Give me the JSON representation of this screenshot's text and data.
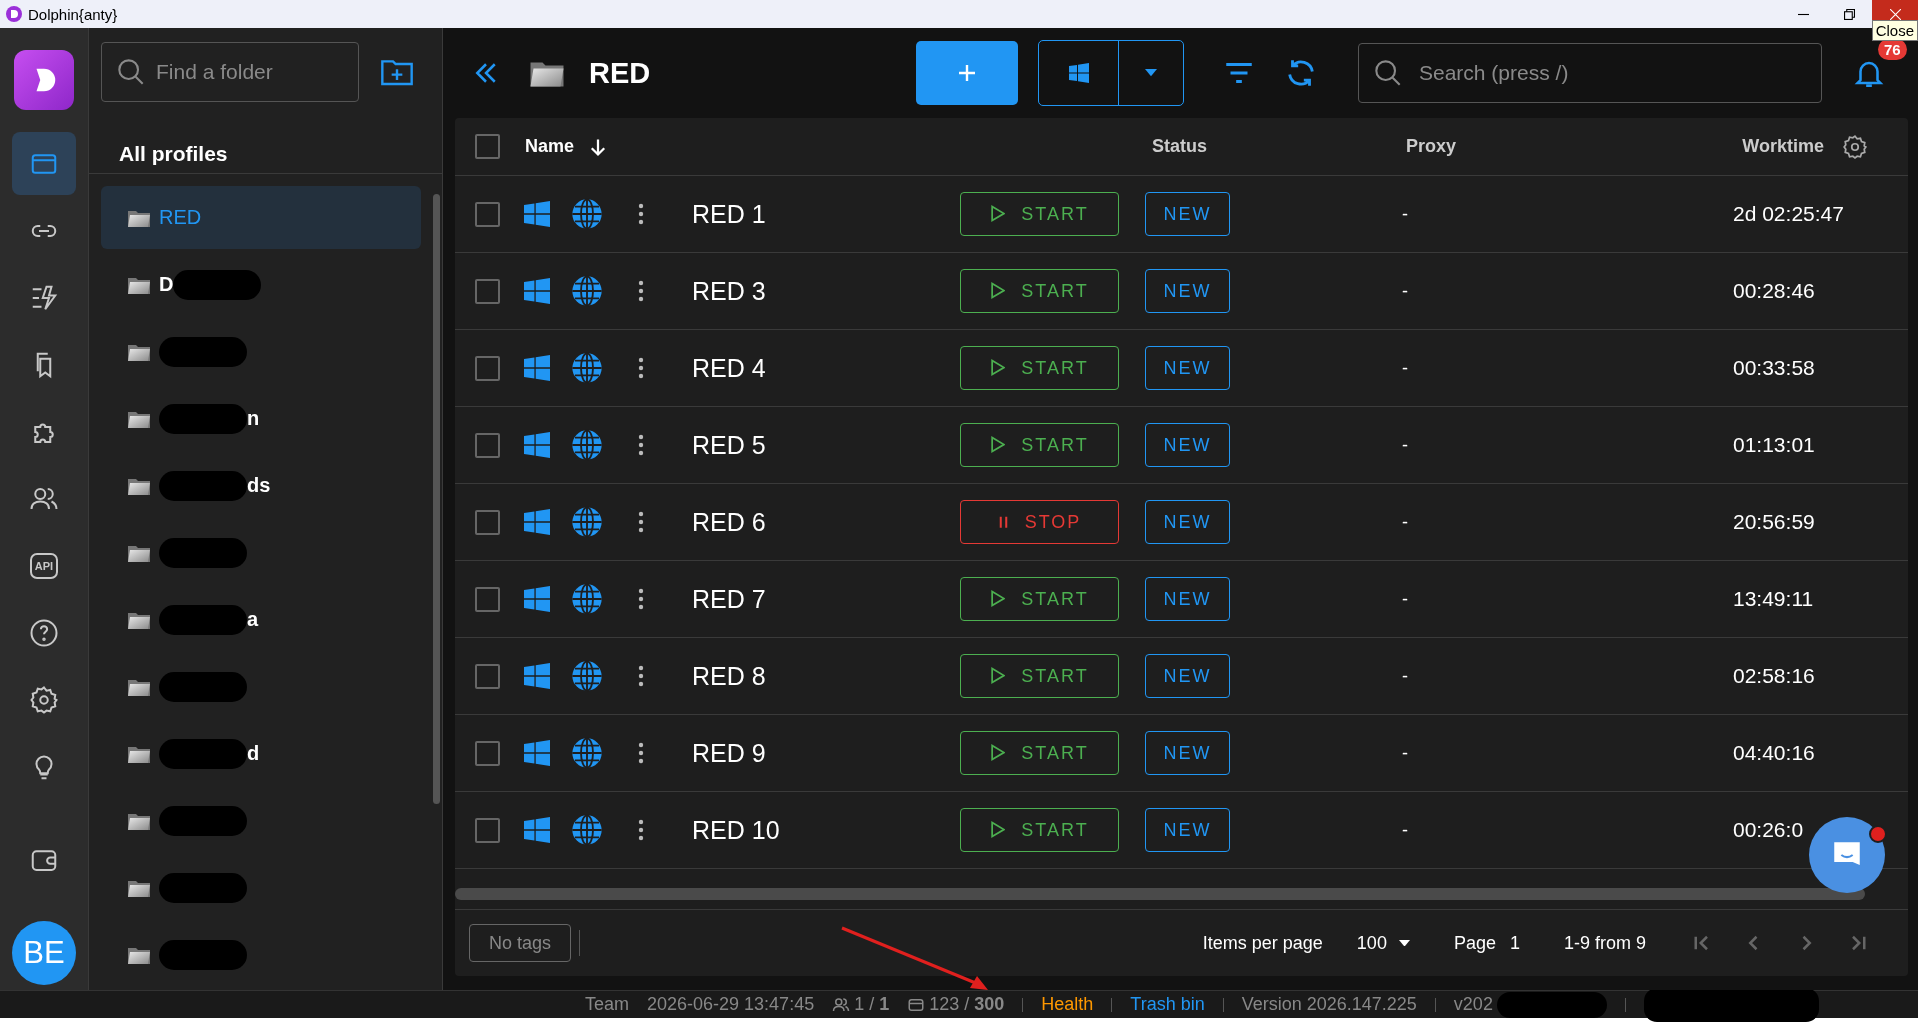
{
  "window": {
    "title": "Dolphin{anty}",
    "tooltip": "Close"
  },
  "rail": [
    {
      "kind": "browser",
      "selected": true
    },
    {
      "kind": "link",
      "selected": false
    },
    {
      "kind": "automation",
      "selected": false
    },
    {
      "kind": "bookmarks",
      "selected": false
    },
    {
      "kind": "puzzle",
      "selected": false
    },
    {
      "kind": "users",
      "selected": false
    },
    {
      "kind": "api",
      "label": "API",
      "selected": false
    },
    {
      "kind": "help",
      "selected": false
    },
    {
      "kind": "settings",
      "selected": false
    },
    {
      "kind": "bulb",
      "selected": false
    },
    {
      "kind": "wallet",
      "selected": false
    }
  ],
  "avatar": "BE",
  "folder_panel": {
    "search_placeholder": "Find a folder",
    "heading": "All profiles",
    "folders": [
      {
        "name": "RED",
        "selected": true,
        "redacted": false
      },
      {
        "name": "D",
        "selected": false,
        "redacted": true,
        "kind": "prefix"
      },
      {
        "selected": false,
        "redacted": true
      },
      {
        "name": "n",
        "selected": false,
        "redacted": true,
        "kind": "suffix"
      },
      {
        "name": "ds",
        "selected": false,
        "redacted": true,
        "kind": "suffix"
      },
      {
        "selected": false,
        "redacted": true
      },
      {
        "name": "a",
        "selected": false,
        "redacted": true,
        "kind": "suffix"
      },
      {
        "selected": false,
        "redacted": true
      },
      {
        "name": "d",
        "selected": false,
        "redacted": true,
        "kind": "suffix"
      },
      {
        "selected": false,
        "redacted": true
      },
      {
        "selected": false,
        "redacted": true
      },
      {
        "selected": false,
        "redacted": true
      }
    ]
  },
  "toolbar": {
    "folder_title": "RED",
    "search_placeholder": "Search (press /)",
    "notifications": "76"
  },
  "table": {
    "all_checked": false,
    "columns": [
      "Name",
      "Status",
      "Proxy",
      "Worktime"
    ],
    "rows": [
      {
        "checked": false,
        "name": "RED 1",
        "running": false,
        "action": "START",
        "status": "NEW",
        "proxy": "-",
        "worktime": "2d 02:25:47"
      },
      {
        "checked": false,
        "name": "RED 3",
        "running": false,
        "action": "START",
        "status": "NEW",
        "proxy": "-",
        "worktime": "00:28:46"
      },
      {
        "checked": false,
        "name": "RED 4",
        "running": false,
        "action": "START",
        "status": "NEW",
        "proxy": "-",
        "worktime": "00:33:58"
      },
      {
        "checked": false,
        "name": "RED 5",
        "running": false,
        "action": "START",
        "status": "NEW",
        "proxy": "-",
        "worktime": "01:13:01"
      },
      {
        "checked": false,
        "name": "RED 6",
        "running": true,
        "action": "STOP",
        "status": "NEW",
        "proxy": "-",
        "worktime": "20:56:59"
      },
      {
        "checked": false,
        "name": "RED 7",
        "running": false,
        "action": "START",
        "status": "NEW",
        "proxy": "-",
        "worktime": "13:49:11"
      },
      {
        "checked": false,
        "name": "RED 8",
        "running": false,
        "action": "START",
        "status": "NEW",
        "proxy": "-",
        "worktime": "02:58:16"
      },
      {
        "checked": false,
        "name": "RED 9",
        "running": false,
        "action": "START",
        "status": "NEW",
        "proxy": "-",
        "worktime": "04:40:16"
      },
      {
        "checked": false,
        "name": "RED 10",
        "running": false,
        "action": "START",
        "status": "NEW",
        "proxy": "-",
        "worktime": "00:26:0"
      }
    ]
  },
  "footer": {
    "tags": "No tags",
    "items_per_page_label": "Items per page",
    "items_per_page": "100",
    "page_label": "Page",
    "page": "1",
    "range": "1-9 from 9"
  },
  "status_bar": {
    "team": "Team",
    "datetime": "2026-06-29 13:47:45",
    "users": "1 / **1**",
    "profiles": "123 / **300**",
    "health": "Health",
    "trash": "Trash bin",
    "version": "Version 2026.147.225",
    "build": "v202"
  }
}
